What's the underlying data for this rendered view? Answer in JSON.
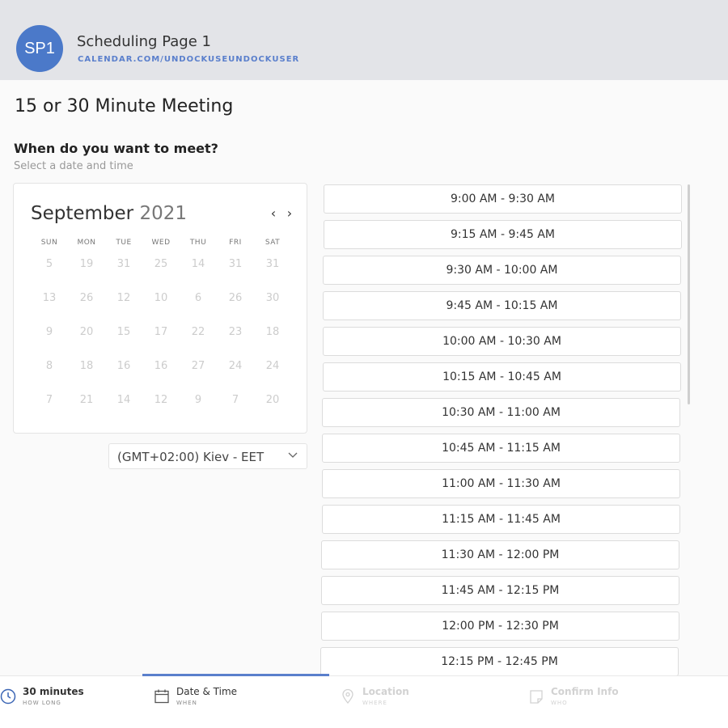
{
  "header": {
    "avatar_initials": "SP1",
    "page_name": "Scheduling Page 1",
    "page_url": "CALENDAR.COM/UNDOCKUSEUNDOCKUSER",
    "accent_color": "#4b79c9"
  },
  "main": {
    "meeting_title": "15 or 30 Minute Meeting",
    "question": "When do you want to meet?",
    "instruction": "Select a date and time"
  },
  "calendar": {
    "month": "September",
    "year": "2021",
    "prev_icon": "chevron-left-icon",
    "next_icon": "chevron-right-icon",
    "days_of_week": [
      "SUN",
      "MON",
      "TUE",
      "WED",
      "THU",
      "FRI",
      "SAT"
    ],
    "weeks": [
      [
        "5",
        "19",
        "31",
        "25",
        "14",
        "31",
        "31"
      ],
      [
        "13",
        "26",
        "12",
        "10",
        "6",
        "26",
        "30"
      ],
      [
        "9",
        "20",
        "15",
        "17",
        "22",
        "23",
        "18"
      ],
      [
        "8",
        "18",
        "16",
        "16",
        "27",
        "24",
        "24"
      ],
      [
        "7",
        "21",
        "14",
        "12",
        "9",
        "7",
        "20"
      ]
    ]
  },
  "timezone": {
    "selected": "(GMT+02:00) Kiev - EET",
    "icon": "chevron-down-icon"
  },
  "time_slots": [
    "9:00 AM - 9:30 AM",
    "9:15 AM - 9:45 AM",
    "9:30 AM - 10:00 AM",
    "9:45 AM - 10:15 AM",
    "10:00 AM - 10:30 AM",
    "10:15 AM - 10:45 AM",
    "10:30 AM - 11:00 AM",
    "10:45 AM - 11:15 AM",
    "11:00 AM - 11:30 AM",
    "11:15 AM - 11:45 AM",
    "11:30 AM - 12:00 PM",
    "11:45 AM - 12:15 PM",
    "12:00 PM - 12:30 PM",
    "12:15 PM - 12:45 PM"
  ],
  "steps": [
    {
      "label": "30 minutes",
      "sub": "HOW LONG",
      "icon": "clock-icon",
      "state": "done"
    },
    {
      "label": "Date & Time",
      "sub": "WHEN",
      "icon": "calendar-icon",
      "state": "active"
    },
    {
      "label": "Location",
      "sub": "WHERE",
      "icon": "location-pin-icon",
      "state": "disabled"
    },
    {
      "label": "Confirm Info",
      "sub": "WHO",
      "icon": "note-icon",
      "state": "disabled"
    }
  ]
}
